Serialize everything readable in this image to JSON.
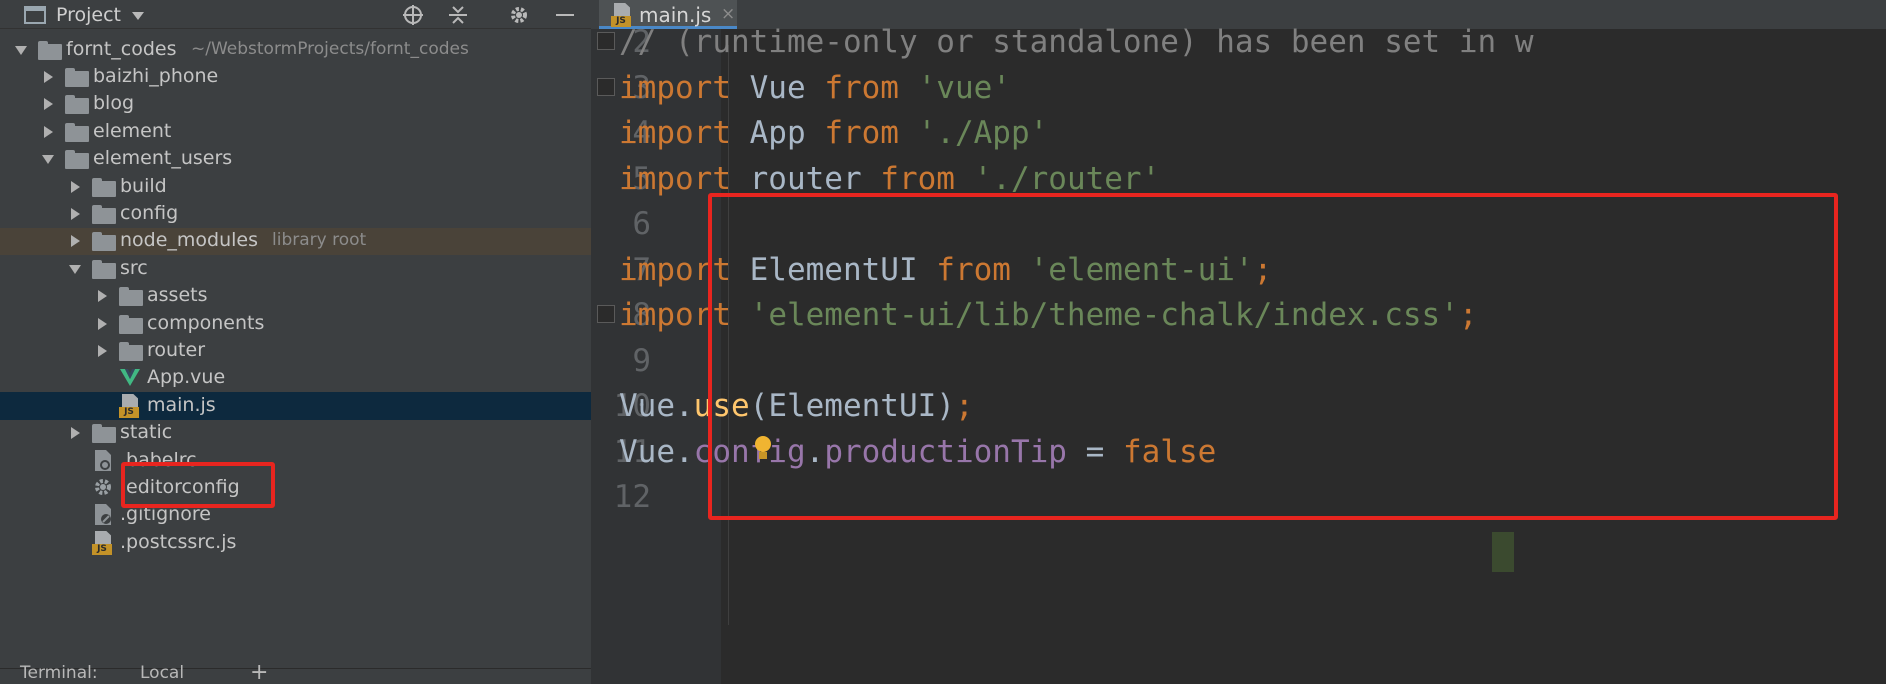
{
  "project_panel": {
    "title": "Project",
    "dropdown_icon": "chevron-down-icon",
    "header_icons": [
      "crosshair-icon",
      "collapse-icon",
      "gear-icon",
      "minimize-icon"
    ]
  },
  "tree": [
    {
      "name": "fornt_codes",
      "sub": "~/WebstormProjects/fornt_codes",
      "type": "folder",
      "depth": 0,
      "expanded": true
    },
    {
      "name": "baizhi_phone",
      "sub": "",
      "type": "folder",
      "depth": 1,
      "expanded": false
    },
    {
      "name": "blog",
      "sub": "",
      "type": "folder",
      "depth": 1,
      "expanded": false
    },
    {
      "name": "element",
      "sub": "",
      "type": "folder",
      "depth": 1,
      "expanded": false
    },
    {
      "name": "element_users",
      "sub": "",
      "type": "folder",
      "depth": 1,
      "expanded": true
    },
    {
      "name": "build",
      "sub": "",
      "type": "folder",
      "depth": 2,
      "expanded": false
    },
    {
      "name": "config",
      "sub": "",
      "type": "folder",
      "depth": 2,
      "expanded": false
    },
    {
      "name": "node_modules",
      "sub": "library root",
      "type": "folder",
      "depth": 2,
      "expanded": false,
      "highlight": true
    },
    {
      "name": "src",
      "sub": "",
      "type": "folder",
      "depth": 2,
      "expanded": true
    },
    {
      "name": "assets",
      "sub": "",
      "type": "folder",
      "depth": 3,
      "expanded": false
    },
    {
      "name": "components",
      "sub": "",
      "type": "folder",
      "depth": 3,
      "expanded": false
    },
    {
      "name": "router",
      "sub": "",
      "type": "folder",
      "depth": 3,
      "expanded": false
    },
    {
      "name": "App.vue",
      "sub": "",
      "type": "vue",
      "depth": 3
    },
    {
      "name": "main.js",
      "sub": "",
      "type": "js",
      "depth": 3,
      "selected": true
    },
    {
      "name": "static",
      "sub": "",
      "type": "folder",
      "depth": 2,
      "expanded": false
    },
    {
      "name": ".babelrc",
      "sub": "",
      "type": "babel",
      "depth": 2
    },
    {
      "name": ".editorconfig",
      "sub": "",
      "type": "gear",
      "depth": 2
    },
    {
      "name": ".gitignore",
      "sub": "",
      "type": "gitignore",
      "depth": 2
    },
    {
      "name": ".postcssrc.js",
      "sub": "",
      "type": "js",
      "depth": 2
    }
  ],
  "bottom": {
    "terminal": "Terminal:",
    "local": "Local",
    "add": "+"
  },
  "editor": {
    "tab_label": "main.js",
    "tab_close": "×",
    "badge": "JS",
    "lines": [
      {
        "num": "2",
        "tokens": [
          {
            "t": "// (runtime-only or standalone) has been set in w",
            "c": "cmt"
          }
        ]
      },
      {
        "num": "3",
        "tokens": [
          {
            "t": "import",
            "c": "kw"
          },
          {
            "t": " Vue ",
            "c": "plain"
          },
          {
            "t": "from",
            "c": "kw"
          },
          {
            "t": " ",
            "c": "plain"
          },
          {
            "t": "'vue'",
            "c": "str"
          }
        ]
      },
      {
        "num": "4",
        "tokens": [
          {
            "t": "import",
            "c": "kw"
          },
          {
            "t": " App ",
            "c": "plain"
          },
          {
            "t": "from",
            "c": "kw"
          },
          {
            "t": " ",
            "c": "plain"
          },
          {
            "t": "'./App'",
            "c": "str"
          }
        ]
      },
      {
        "num": "5",
        "tokens": [
          {
            "t": "import",
            "c": "kw"
          },
          {
            "t": " router ",
            "c": "plain"
          },
          {
            "t": "from",
            "c": "kw"
          },
          {
            "t": " ",
            "c": "plain"
          },
          {
            "t": "'./router'",
            "c": "str"
          }
        ]
      },
      {
        "num": "6",
        "tokens": []
      },
      {
        "num": "7",
        "tokens": [
          {
            "t": "import",
            "c": "kw"
          },
          {
            "t": " ElementUI ",
            "c": "plain"
          },
          {
            "t": "from",
            "c": "kw"
          },
          {
            "t": " ",
            "c": "plain"
          },
          {
            "t": "'element-ui'",
            "c": "str"
          },
          {
            "t": ";",
            "c": "kw"
          }
        ]
      },
      {
        "num": "8",
        "tokens": [
          {
            "t": "import",
            "c": "kw"
          },
          {
            "t": " ",
            "c": "plain"
          },
          {
            "t": "'element-ui/lib/theme-chalk/index.css'",
            "c": "str"
          },
          {
            "t": ";",
            "c": "kw"
          }
        ]
      },
      {
        "num": "9",
        "tokens": []
      },
      {
        "num": "10",
        "tokens": [
          {
            "t": "Vue.",
            "c": "plain"
          },
          {
            "t": "use",
            "c": "fn"
          },
          {
            "t": "(ElementUI)",
            "c": "plain"
          },
          {
            "t": ";",
            "c": "kw"
          }
        ]
      },
      {
        "num": "11",
        "tokens": [
          {
            "t": "Vue.",
            "c": "plain"
          },
          {
            "t": "config",
            "c": "prop"
          },
          {
            "t": ".",
            "c": "plain"
          },
          {
            "t": "productionTip",
            "c": "prop"
          },
          {
            "t": " = ",
            "c": "plain"
          },
          {
            "t": "false",
            "c": "kw"
          }
        ]
      },
      {
        "num": "12",
        "tokens": []
      }
    ]
  },
  "colors": {
    "keyword": "#cc7832",
    "string": "#6a8759",
    "comment": "#808080",
    "property": "#9876aa",
    "function": "#ffc66d",
    "annotation": "#e8251f"
  }
}
